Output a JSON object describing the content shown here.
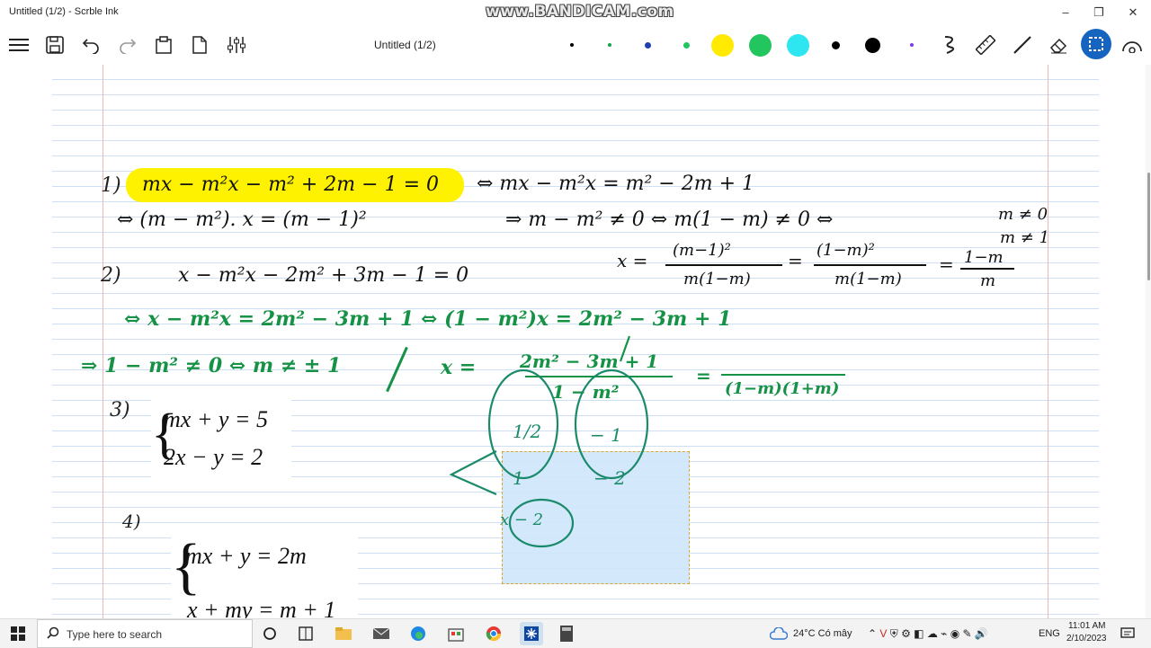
{
  "window": {
    "title": "Untitled (1/2) - Scrble Ink",
    "watermark": "www.BANDICAM.com",
    "minimize": "–",
    "maximize": "❐",
    "close": "✕"
  },
  "toolbar": {
    "doc_title": "Untitled (1/2)",
    "pen_colors": [
      "#000000",
      "#16a34a",
      "#1e40af",
      "#22c55e",
      "#ffea00",
      "#22c55e",
      "#2ee6f0",
      "#000000",
      "#000000",
      "#7c3aed"
    ]
  },
  "notes": {
    "line1_label": "1)",
    "line1_eq": "mx − m²x − m² + 2m − 1 = 0",
    "line1_rhs": "⇔ mx − m²x = m² − 2m + 1",
    "line2": "⇔ (m − m²). x = (m − 1)²",
    "line2_rhs": "⇒ m − m² ≠ 0 ⇔ m(1 − m) ≠ 0 ⇔",
    "cond1": "m ≠ 0",
    "cond2": "m ≠ 1",
    "frac_x": "x =",
    "frac1_num": "(m−1)²",
    "frac1_den": "m(1−m)",
    "frac2_num": "(1−m)²",
    "frac2_den": "m(1−m)",
    "frac3_num": "1−m",
    "frac3_den": "m",
    "line3_label": "2)",
    "line3_eq": "x − m²x − 2m² + 3m − 1 = 0",
    "line4": "⇔ x − m²x = 2m² − 3m + 1 ⇔ (1 − m²)x = 2m² − 3m + 1",
    "line5": "⇒ 1 − m² ≠ 0 ⇔ m ≠ ± 1",
    "line5_x": "x =",
    "frac4_num": "2m² − 3m + 1",
    "frac4_den": "1 − m²",
    "frac5_den": "(1−m)(1+m)",
    "item3_label": "3)",
    "sys3_line1": "mx + y = 5",
    "sys3_line2": "2x − y = 2",
    "item4_label": "4)",
    "sys4_line1": "mx + y = 2m",
    "sys4_line2": "x + my = m + 1",
    "coef_a1": "1/2",
    "coef_b1": "− 1",
    "coef_a2": "1",
    "coef_b2": "− 2",
    "coef_c": "x − 2"
  },
  "taskbar": {
    "search_placeholder": "Type here to search",
    "weather": "24°C Có mây",
    "lang": "ENG",
    "time": "11:01 AM",
    "date": "2/10/2023"
  }
}
